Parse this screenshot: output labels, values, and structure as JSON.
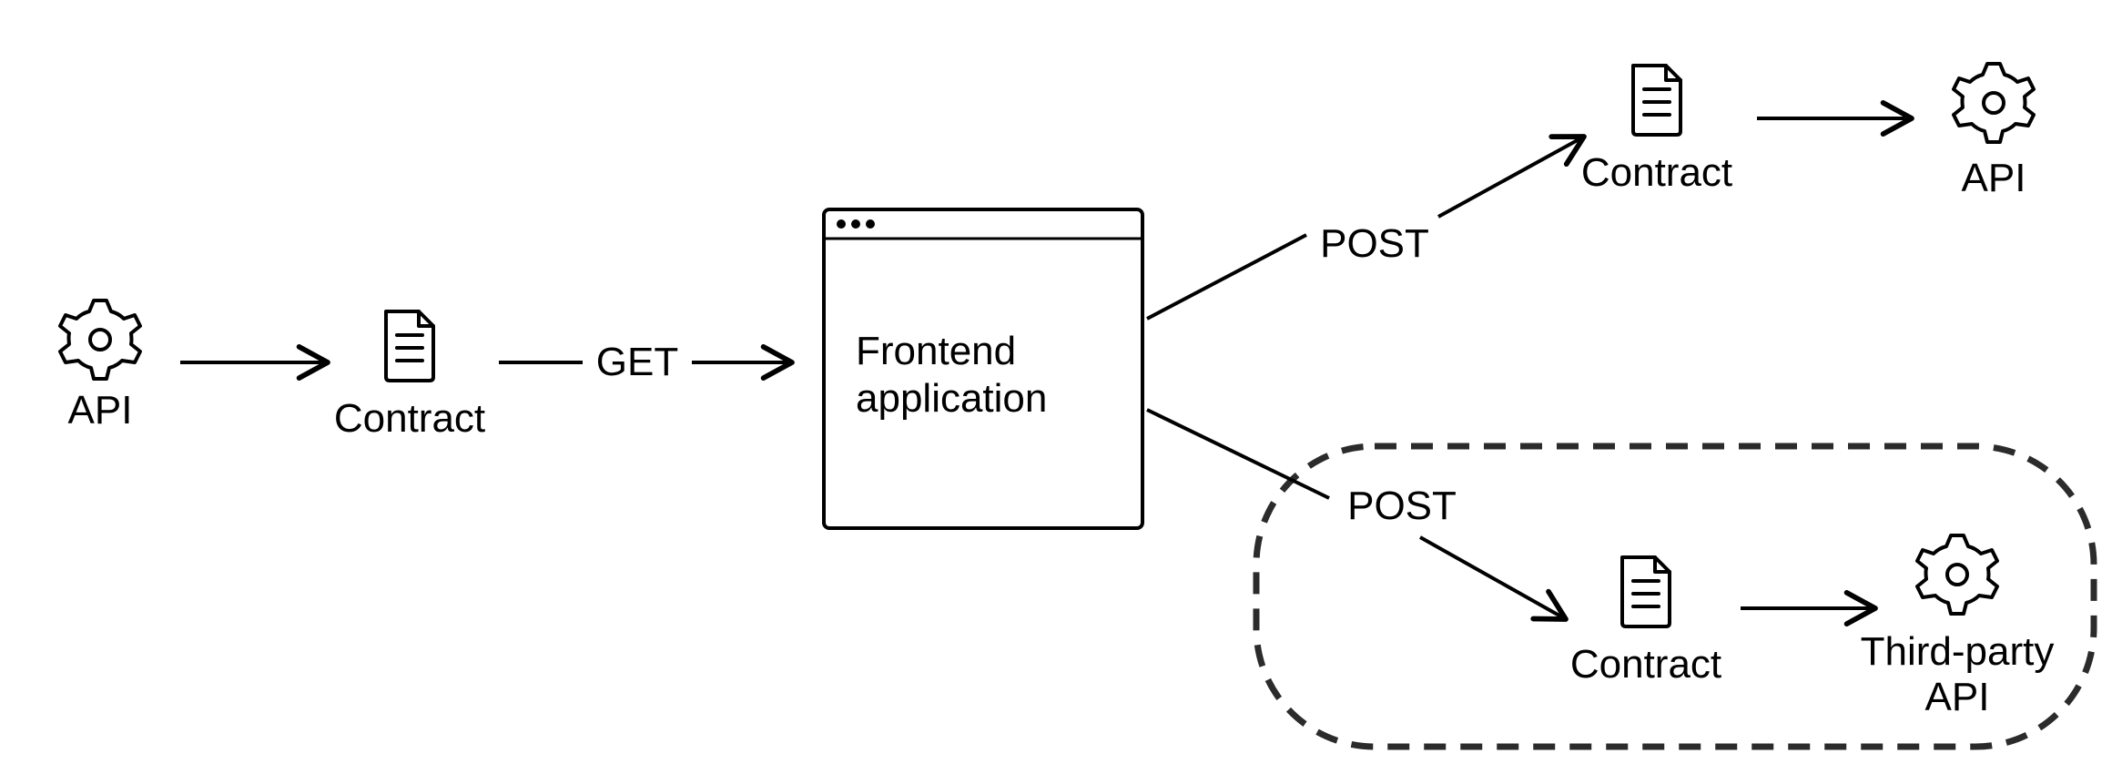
{
  "nodes": {
    "api_left": {
      "label": "API"
    },
    "contract_left": {
      "label": "Contract"
    },
    "frontend": {
      "label_line1": "Frontend",
      "label_line2": "application"
    },
    "contract_top": {
      "label": "Contract"
    },
    "api_top": {
      "label": "API"
    },
    "contract_bot": {
      "label": "Contract"
    },
    "api_bot": {
      "label_line1": "Third-party",
      "label_line2": "API"
    }
  },
  "edges": {
    "get": {
      "label": "GET"
    },
    "post_top": {
      "label": "POST"
    },
    "post_bot": {
      "label": "POST"
    }
  }
}
